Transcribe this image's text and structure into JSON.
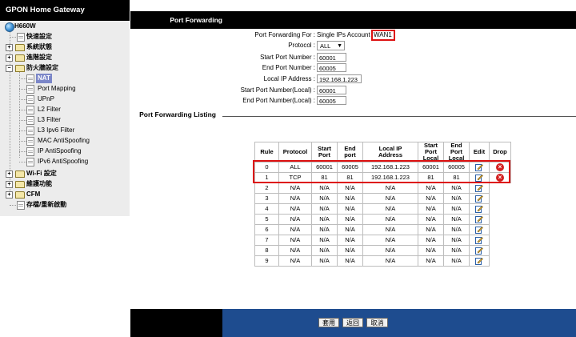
{
  "brand": "GPON Home Gateway",
  "sidebar": {
    "root": "H660W",
    "items": [
      "快速設定",
      "系統狀態",
      "進階設定",
      "防火牆設定"
    ],
    "firewall_children": [
      "NAT",
      "Port Mapping",
      "UPnP",
      "L2 Filter",
      "L3 Filter",
      "L3 Ipv6 Filter",
      "MAC AntiSpoofing",
      "IP AntiSpoofing",
      "IPv6 AntiSpoofing"
    ],
    "more_items": [
      "Wi-Fi 設定",
      "維護功能",
      "CFM",
      "存檔/重新啟動"
    ]
  },
  "header": {
    "title": "Port Forwarding"
  },
  "form": {
    "pf_for_label": "Port Forwarding For :",
    "pf_for_value": "Single IPs Account",
    "pf_for_account": "WAN1",
    "protocol_label": "Protocol :",
    "protocol_value": "ALL",
    "start_port_label": "Start Port Number :",
    "start_port_value": "60001",
    "end_port_label": "End Port Number :",
    "end_port_value": "60005",
    "local_ip_label": "Local IP Address :",
    "local_ip_value": "192.168.1.223",
    "start_local_label": "Start Port Number(Local) :",
    "start_local_value": "60001",
    "end_local_label": "End Port Number(Local) :",
    "end_local_value": "60005"
  },
  "listing_title": "Port Forwarding Listing",
  "table": {
    "headers": {
      "rule": "Rule",
      "protocol": "Protocol",
      "start_port_1": "Start",
      "start_port_2": "Port",
      "end_port_1": "End",
      "end_port_2": "port",
      "local_ip_1": "Local IP",
      "local_ip_2": "Address",
      "start_local_1": "Start",
      "start_local_2": "Port",
      "start_local_3": "Local",
      "end_local_1": "End",
      "end_local_2": "Port",
      "end_local_3": "Local",
      "edit": "Edit",
      "drop": "Drop"
    },
    "rows": [
      {
        "rule": "0",
        "protocol": "ALL",
        "start": "60001",
        "end": "60005",
        "ip": "192.168.1.223",
        "slocal": "60001",
        "elocal": "60005",
        "drop": true
      },
      {
        "rule": "1",
        "protocol": "TCP",
        "start": "81",
        "end": "81",
        "ip": "192.168.1.223",
        "slocal": "81",
        "elocal": "81",
        "drop": true
      },
      {
        "rule": "2",
        "protocol": "N/A",
        "start": "N/A",
        "end": "N/A",
        "ip": "N/A",
        "slocal": "N/A",
        "elocal": "N/A",
        "drop": false
      },
      {
        "rule": "3",
        "protocol": "N/A",
        "start": "N/A",
        "end": "N/A",
        "ip": "N/A",
        "slocal": "N/A",
        "elocal": "N/A",
        "drop": false
      },
      {
        "rule": "4",
        "protocol": "N/A",
        "start": "N/A",
        "end": "N/A",
        "ip": "N/A",
        "slocal": "N/A",
        "elocal": "N/A",
        "drop": false
      },
      {
        "rule": "5",
        "protocol": "N/A",
        "start": "N/A",
        "end": "N/A",
        "ip": "N/A",
        "slocal": "N/A",
        "elocal": "N/A",
        "drop": false
      },
      {
        "rule": "6",
        "protocol": "N/A",
        "start": "N/A",
        "end": "N/A",
        "ip": "N/A",
        "slocal": "N/A",
        "elocal": "N/A",
        "drop": false
      },
      {
        "rule": "7",
        "protocol": "N/A",
        "start": "N/A",
        "end": "N/A",
        "ip": "N/A",
        "slocal": "N/A",
        "elocal": "N/A",
        "drop": false
      },
      {
        "rule": "8",
        "protocol": "N/A",
        "start": "N/A",
        "end": "N/A",
        "ip": "N/A",
        "slocal": "N/A",
        "elocal": "N/A",
        "drop": false
      },
      {
        "rule": "9",
        "protocol": "N/A",
        "start": "N/A",
        "end": "N/A",
        "ip": "N/A",
        "slocal": "N/A",
        "elocal": "N/A",
        "drop": false
      }
    ]
  },
  "buttons": {
    "apply": "套用",
    "back": "返回",
    "cancel": "取消"
  },
  "colors": {
    "highlight_red": "#d11111",
    "bottom_bar": "#1e4c8f",
    "nav_selected": "#7b86c8"
  }
}
